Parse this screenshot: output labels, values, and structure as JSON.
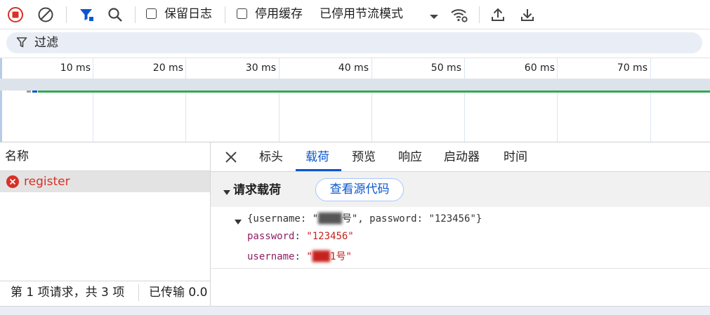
{
  "toolbar": {
    "preserve_log_label": "保留日志",
    "disable_cache_label": "停用缓存",
    "throttling_value": "已停用节流模式"
  },
  "filter": {
    "placeholder": "过滤"
  },
  "timeline": {
    "ticks": [
      "10 ms",
      "20 ms",
      "30 ms",
      "40 ms",
      "50 ms",
      "60 ms",
      "70 ms"
    ]
  },
  "request_list": {
    "header": "名称",
    "rows": [
      {
        "name": "register",
        "status": "error"
      }
    ]
  },
  "status_bar": {
    "requests_summary": "第 1 项请求，共 3 项",
    "transferred": "已传输 0.0"
  },
  "detail": {
    "tabs": [
      "标头",
      "载荷",
      "预览",
      "响应",
      "启动器",
      "时间"
    ],
    "active_tab": "载荷",
    "section_title": "请求载荷",
    "view_source_button": "查看源代码",
    "payload_summary_prefix": "{username: \"",
    "payload_summary_blurred": "████",
    "payload_summary_suffix": "号\", password: \"123456\"}",
    "fields": [
      {
        "key": "password",
        "value": "\"123456\""
      },
      {
        "key": "username",
        "value_prefix": "\"",
        "value_blurred": "███",
        "value_suffix": "1号\""
      }
    ]
  },
  "colors": {
    "accent": "#0b57d0",
    "error": "#d93025",
    "key": "#8e1e63",
    "string": "#c5221f",
    "timeline_bar": "#34a853"
  }
}
